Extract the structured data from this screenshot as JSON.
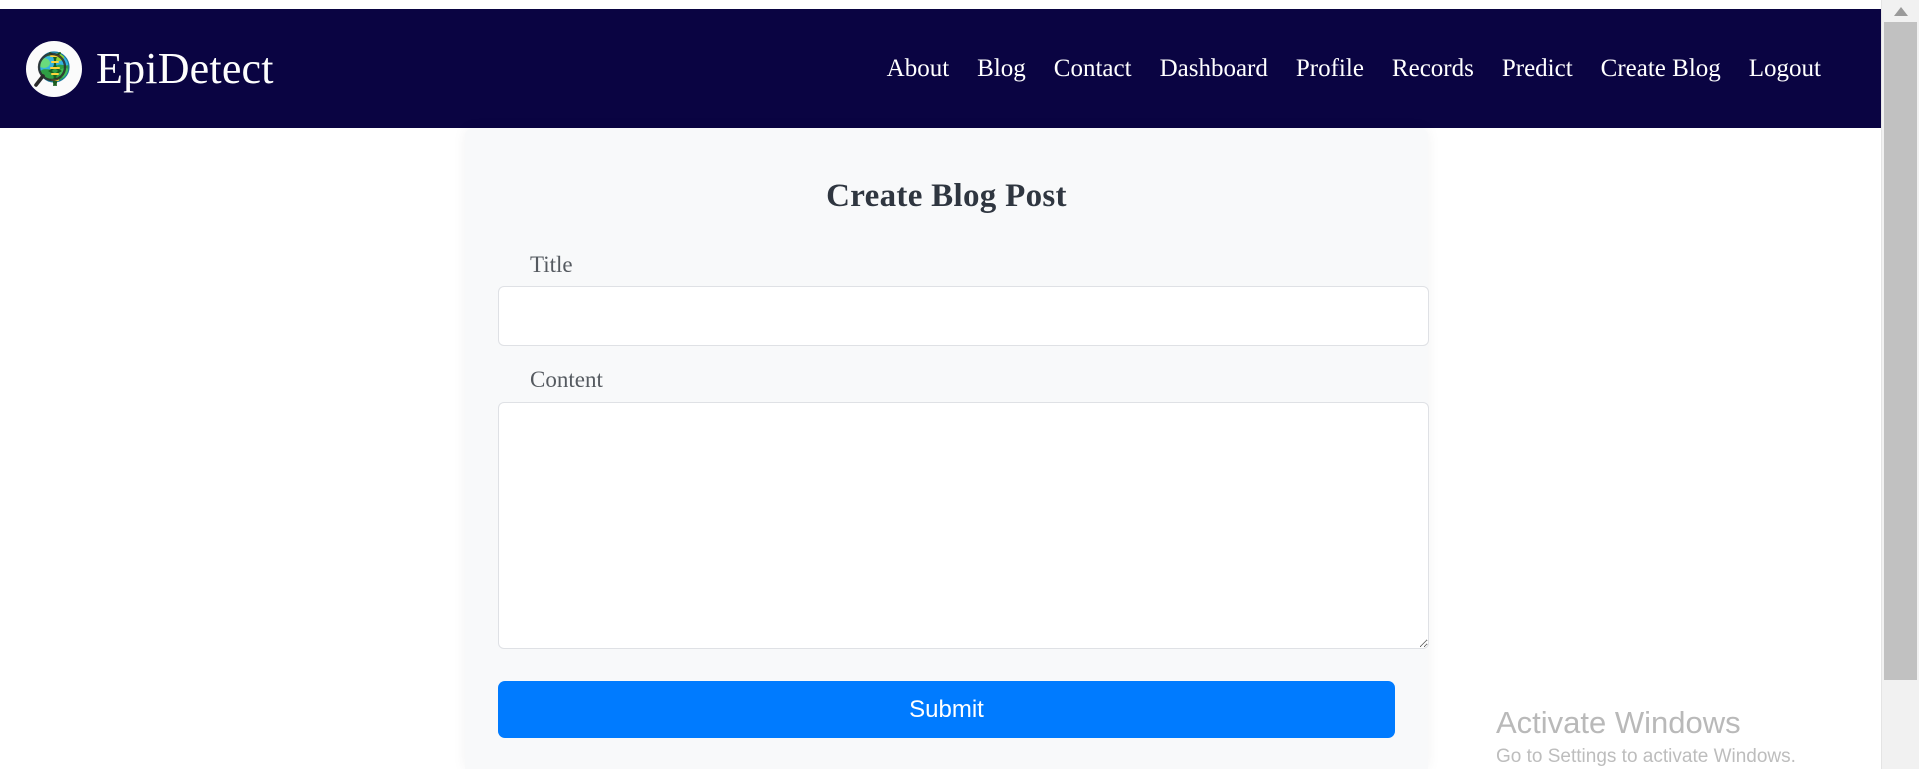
{
  "navbar": {
    "brand": {
      "name": "EpiDetect",
      "logo_icon": "epidetect-globe-dna-magnifier-logo",
      "background_color": "#0a0442",
      "text_color": "#ffffff"
    },
    "links": [
      {
        "label": "About"
      },
      {
        "label": "Blog"
      },
      {
        "label": "Contact"
      },
      {
        "label": "Dashboard"
      },
      {
        "label": "Profile"
      },
      {
        "label": "Records"
      },
      {
        "label": "Predict"
      },
      {
        "label": "Create Blog"
      },
      {
        "label": "Logout"
      }
    ]
  },
  "card": {
    "title": "Create Blog Post",
    "fields": [
      {
        "label": "Title",
        "value": "",
        "placeholder": ""
      },
      {
        "label": "Content",
        "value": "",
        "placeholder": ""
      }
    ],
    "submit_label": "Submit",
    "submit_color": "#007bff",
    "background_color": "#f8f9fa"
  },
  "watermark": {
    "title": "Activate Windows",
    "subtitle": "Go to Settings to activate Windows."
  },
  "scrollbar": {
    "up_arrow_icon": "chevron-up-icon"
  }
}
